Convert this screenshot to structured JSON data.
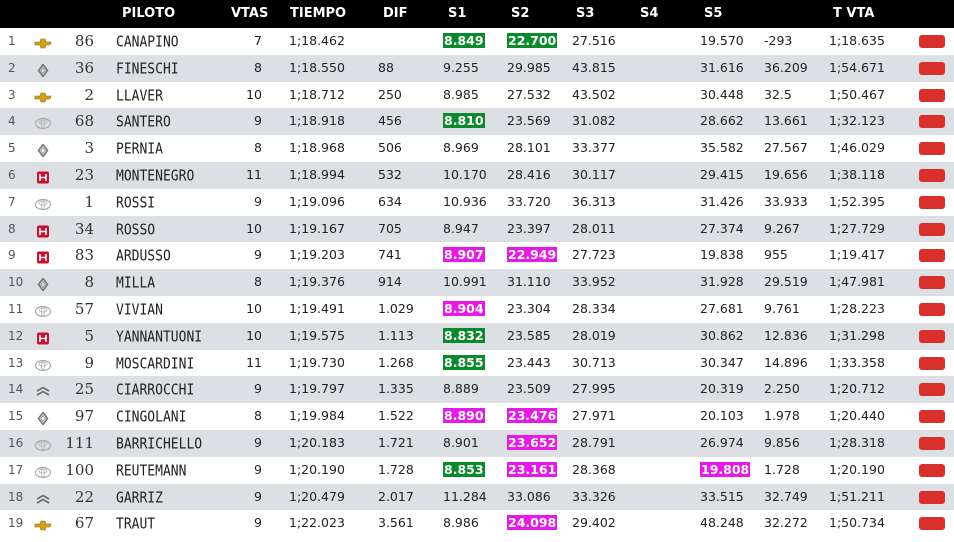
{
  "headers": {
    "piloto": "PILOTO",
    "vtas": "VTAS",
    "tiempo": "TIEMPO",
    "dif": "DIF",
    "s1": "S1",
    "s2": "S2",
    "s3": "S3",
    "s4": "S4",
    "s5": "S5",
    "tvta": "T VTA"
  },
  "colors": {
    "green": "#0a8a2a",
    "magenta": "#e619e6",
    "button": "#d9302c",
    "header_bg": "#000000",
    "row_alt": "#dcdfe3"
  },
  "rows": [
    {
      "pos": "1",
      "brand": "chevrolet",
      "num": "86",
      "name": "CANAPINO",
      "vtas": "7",
      "tiempo": "1;18.462",
      "dif": "",
      "s1": "8.849",
      "s1_hl": "green",
      "s2": "22.700",
      "s2_hl": "green",
      "s3": "27.516",
      "s5": "19.570",
      "s5_hl": "",
      "extra": "-293",
      "tvta": "1;18.635"
    },
    {
      "pos": "2",
      "brand": "renault",
      "num": "36",
      "name": "FINESCHI",
      "vtas": "8",
      "tiempo": "1;18.550",
      "dif": "88",
      "s1": "9.255",
      "s1_hl": "",
      "s2": "29.985",
      "s2_hl": "",
      "s3": "43.815",
      "s5": "31.616",
      "s5_hl": "",
      "extra": "36.209",
      "tvta": "1;54.671"
    },
    {
      "pos": "3",
      "brand": "chevrolet",
      "num": "2",
      "name": "LLAVER",
      "vtas": "10",
      "tiempo": "1;18.712",
      "dif": "250",
      "s1": "8.985",
      "s1_hl": "",
      "s2": "27.532",
      "s2_hl": "",
      "s3": "43.502",
      "s5": "30.448",
      "s5_hl": "",
      "extra": "32.5",
      "tvta": "1;50.467"
    },
    {
      "pos": "4",
      "brand": "toyota",
      "num": "68",
      "name": "SANTERO",
      "vtas": "9",
      "tiempo": "1;18.918",
      "dif": "456",
      "s1": "8.810",
      "s1_hl": "green",
      "s2": "23.569",
      "s2_hl": "",
      "s3": "31.082",
      "s5": "28.662",
      "s5_hl": "",
      "extra": "13.661",
      "tvta": "1;32.123"
    },
    {
      "pos": "5",
      "brand": "renault",
      "num": "3",
      "name": "PERNIA",
      "vtas": "8",
      "tiempo": "1;18.968",
      "dif": "506",
      "s1": "8.969",
      "s1_hl": "",
      "s2": "28.101",
      "s2_hl": "",
      "s3": "33.377",
      "s5": "35.582",
      "s5_hl": "",
      "extra": "27.567",
      "tvta": "1;46.029"
    },
    {
      "pos": "6",
      "brand": "honda",
      "num": "23",
      "name": "MONTENEGRO",
      "vtas": "11",
      "tiempo": "1;18.994",
      "dif": "532",
      "s1": "10.170",
      "s1_hl": "",
      "s2": "28.416",
      "s2_hl": "",
      "s3": "30.117",
      "s5": "29.415",
      "s5_hl": "",
      "extra": "19.656",
      "tvta": "1;38.118"
    },
    {
      "pos": "7",
      "brand": "toyota",
      "num": "1",
      "name": "ROSSI",
      "vtas": "9",
      "tiempo": "1;19.096",
      "dif": "634",
      "s1": "10.936",
      "s1_hl": "",
      "s2": "33.720",
      "s2_hl": "",
      "s3": "36.313",
      "s5": "31.426",
      "s5_hl": "",
      "extra": "33.933",
      "tvta": "1;52.395"
    },
    {
      "pos": "8",
      "brand": "honda",
      "num": "34",
      "name": "ROSSO",
      "vtas": "10",
      "tiempo": "1;19.167",
      "dif": "705",
      "s1": "8.947",
      "s1_hl": "",
      "s2": "23.397",
      "s2_hl": "",
      "s3": "28.011",
      "s5": "27.374",
      "s5_hl": "",
      "extra": "9.267",
      "tvta": "1;27.729"
    },
    {
      "pos": "9",
      "brand": "honda",
      "num": "83",
      "name": "ARDUSSO",
      "vtas": "9",
      "tiempo": "1;19.203",
      "dif": "741",
      "s1": "8.907",
      "s1_hl": "magenta",
      "s2": "22.949",
      "s2_hl": "magenta",
      "s3": "27.723",
      "s5": "19.838",
      "s5_hl": "",
      "extra": "955",
      "tvta": "1;19.417"
    },
    {
      "pos": "10",
      "brand": "renault",
      "num": "8",
      "name": "MILLA",
      "vtas": "8",
      "tiempo": "1;19.376",
      "dif": "914",
      "s1": "10.991",
      "s1_hl": "",
      "s2": "31.110",
      "s2_hl": "",
      "s3": "33.952",
      "s5": "31.928",
      "s5_hl": "",
      "extra": "29.519",
      "tvta": "1;47.981"
    },
    {
      "pos": "11",
      "brand": "toyota",
      "num": "57",
      "name": "VIVIAN",
      "vtas": "10",
      "tiempo": "1;19.491",
      "dif": "1.029",
      "s1": "8.904",
      "s1_hl": "magenta",
      "s2": "23.304",
      "s2_hl": "",
      "s3": "28.334",
      "s5": "27.681",
      "s5_hl": "",
      "extra": "9.761",
      "tvta": "1;28.223"
    },
    {
      "pos": "12",
      "brand": "honda",
      "num": "5",
      "name": "YANNANTUONI",
      "vtas": "10",
      "tiempo": "1;19.575",
      "dif": "1.113",
      "s1": "8.832",
      "s1_hl": "green",
      "s2": "23.585",
      "s2_hl": "",
      "s3": "28.019",
      "s5": "30.862",
      "s5_hl": "",
      "extra": "12.836",
      "tvta": "1;31.298"
    },
    {
      "pos": "13",
      "brand": "toyota",
      "num": "9",
      "name": "MOSCARDINI",
      "vtas": "11",
      "tiempo": "1;19.730",
      "dif": "1.268",
      "s1": "8.855",
      "s1_hl": "green",
      "s2": "23.443",
      "s2_hl": "",
      "s3": "30.713",
      "s5": "30.347",
      "s5_hl": "",
      "extra": "14.896",
      "tvta": "1;33.358"
    },
    {
      "pos": "14",
      "brand": "citroen",
      "num": "25",
      "name": "CIARROCCHI",
      "vtas": "9",
      "tiempo": "1;19.797",
      "dif": "1.335",
      "s1": "8.889",
      "s1_hl": "",
      "s2": "23.509",
      "s2_hl": "",
      "s3": "27.995",
      "s5": "20.319",
      "s5_hl": "",
      "extra": "2.250",
      "tvta": "1;20.712"
    },
    {
      "pos": "15",
      "brand": "renault",
      "num": "97",
      "name": "CINGOLANI",
      "vtas": "8",
      "tiempo": "1;19.984",
      "dif": "1.522",
      "s1": "8.890",
      "s1_hl": "magenta",
      "s2": "23.476",
      "s2_hl": "magenta",
      "s3": "27.971",
      "s5": "20.103",
      "s5_hl": "",
      "extra": "1.978",
      "tvta": "1;20.440"
    },
    {
      "pos": "16",
      "brand": "toyota",
      "num": "111",
      "name": "BARRICHELLO",
      "vtas": "9",
      "tiempo": "1;20.183",
      "dif": "1.721",
      "s1": "8.901",
      "s1_hl": "",
      "s2": "23.652",
      "s2_hl": "magenta",
      "s3": "28.791",
      "s5": "26.974",
      "s5_hl": "",
      "extra": "9.856",
      "tvta": "1;28.318"
    },
    {
      "pos": "17",
      "brand": "toyota",
      "num": "100",
      "name": "REUTEMANN",
      "vtas": "9",
      "tiempo": "1;20.190",
      "dif": "1.728",
      "s1": "8.853",
      "s1_hl": "green",
      "s2": "23.161",
      "s2_hl": "magenta",
      "s3": "28.368",
      "s5": "19.808",
      "s5_hl": "magenta",
      "extra": "1.728",
      "tvta": "1;20.190"
    },
    {
      "pos": "18",
      "brand": "citroen",
      "num": "22",
      "name": "GARRIZ",
      "vtas": "9",
      "tiempo": "1;20.479",
      "dif": "2.017",
      "s1": "11.284",
      "s1_hl": "",
      "s2": "33.086",
      "s2_hl": "",
      "s3": "33.326",
      "s5": "33.515",
      "s5_hl": "",
      "extra": "32.749",
      "tvta": "1;51.211"
    },
    {
      "pos": "19",
      "brand": "chevrolet",
      "num": "67",
      "name": "TRAUT",
      "vtas": "9",
      "tiempo": "1;22.023",
      "dif": "3.561",
      "s1": "8.986",
      "s1_hl": "",
      "s2": "24.098",
      "s2_hl": "magenta",
      "s3": "29.402",
      "s5": "48.248",
      "s5_hl": "",
      "extra": "32.272",
      "tvta": "1;50.734"
    }
  ]
}
